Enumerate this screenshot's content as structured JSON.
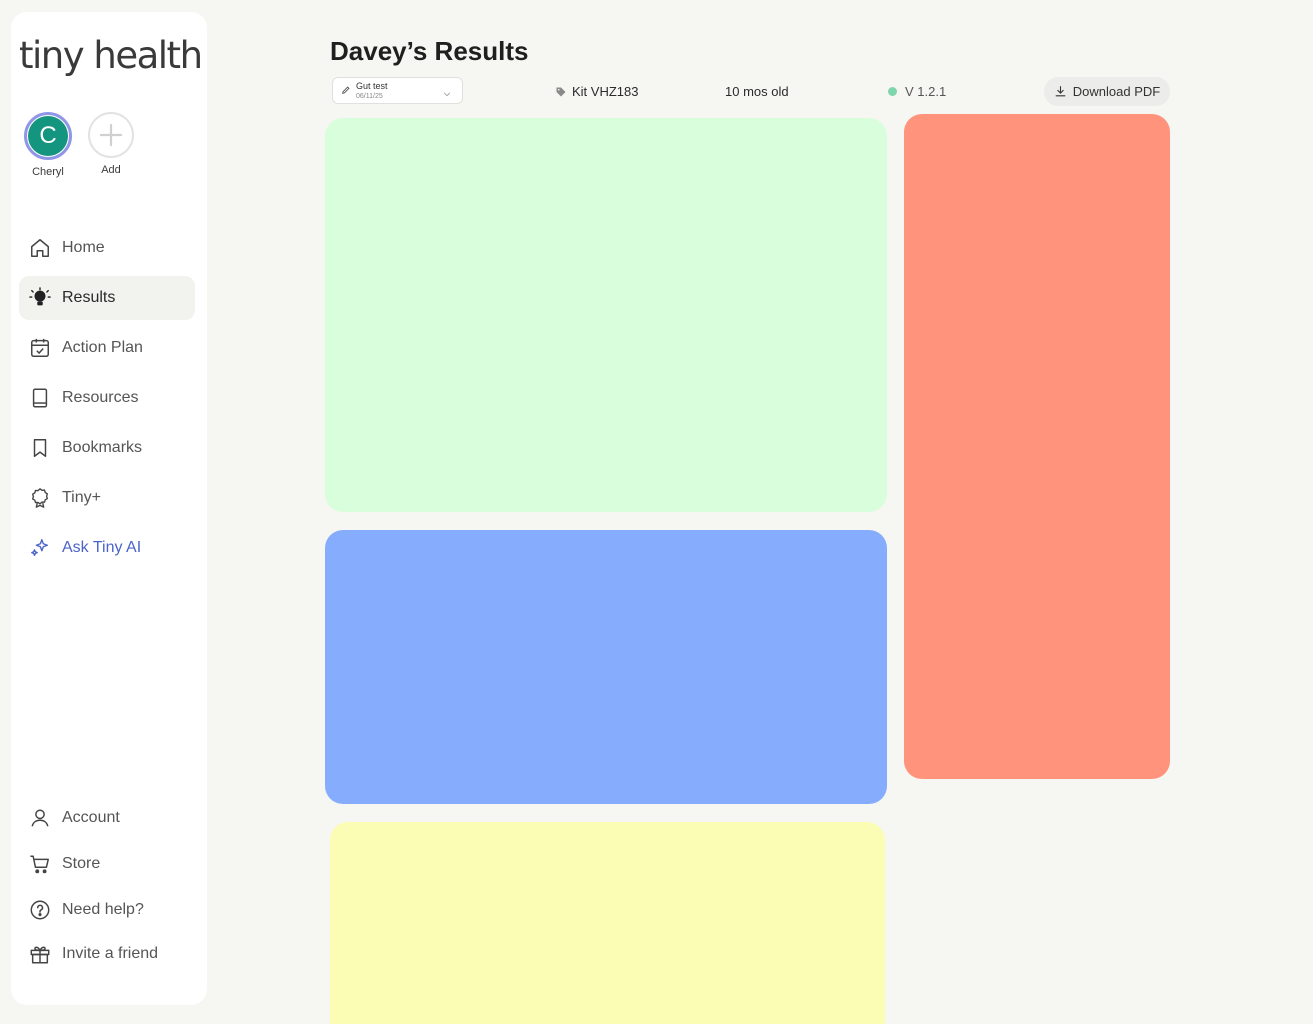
{
  "app": {
    "logo_text": "tiny health"
  },
  "profiles": [
    {
      "initial": "C",
      "name": "Cheryl"
    },
    {
      "name": "Add"
    }
  ],
  "nav": {
    "main": [
      {
        "label": "Home",
        "icon": "home-icon"
      },
      {
        "label": "Results",
        "icon": "lightbulb-icon",
        "active": true
      },
      {
        "label": "Action Plan",
        "icon": "calendar-check-icon"
      },
      {
        "label": "Resources",
        "icon": "book-icon"
      },
      {
        "label": "Bookmarks",
        "icon": "bookmark-icon"
      },
      {
        "label": "Tiny+",
        "icon": "badge-icon"
      },
      {
        "label": "Ask Tiny AI",
        "icon": "sparkle-icon"
      }
    ],
    "bottom": [
      {
        "label": "Account",
        "icon": "user-icon"
      },
      {
        "label": "Store",
        "icon": "cart-icon"
      },
      {
        "label": "Need help?",
        "icon": "help-icon"
      },
      {
        "label": "Invite a friend",
        "icon": "gift-icon"
      }
    ]
  },
  "header": {
    "title": "Davey’s Results",
    "test_select": {
      "label": "Gut test",
      "date": "06/11/25"
    },
    "kit": "Kit VHZ183",
    "age": "10 mos old",
    "version": "V 1.2.1",
    "download_label": "Download PDF"
  },
  "colors": {
    "accent": "#14957f",
    "ai": "#4b64c8",
    "card_green": "#d9fedb",
    "card_blue": "#85acfd",
    "card_yellow": "#fbfdb5",
    "card_salmon": "#ff937c"
  }
}
